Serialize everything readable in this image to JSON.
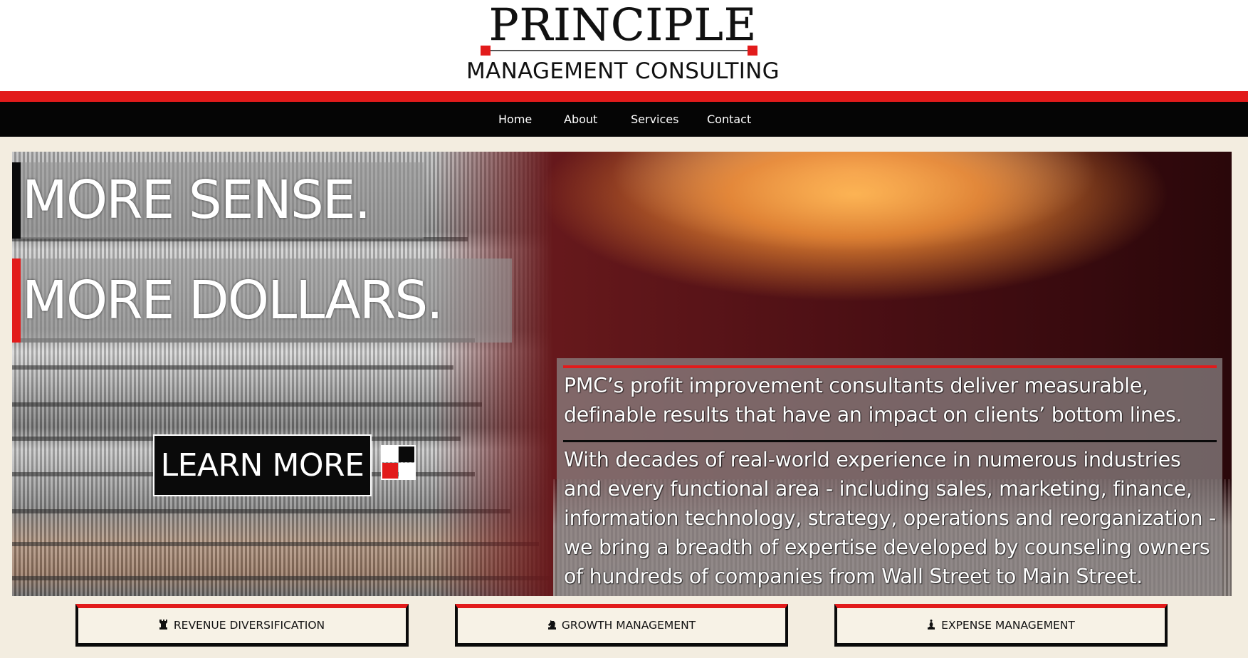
{
  "logo": {
    "name": "PRINCIPLE",
    "subtitle": "MANAGEMENT CONSULTING"
  },
  "nav": {
    "items": [
      {
        "label": "Home"
      },
      {
        "label": "About"
      },
      {
        "label": "Services"
      },
      {
        "label": "Contact"
      }
    ]
  },
  "hero": {
    "headline_1": "MORE SENSE.",
    "headline_2": "MORE DOLLARS.",
    "cta_label": "LEARN MORE",
    "paragraph_1": "PMC’s profit improvement consultants deliver measurable, definable results that have an impact on clients’ bottom lines.",
    "paragraph_2": "With decades of real-world experience in numerous industries and every functional area - including sales, marketing, finance, information technology, strategy, operations and reorganization - we bring a breadth of expertise developed by counseling owners of hundreds of companies from Wall Street to Main Street."
  },
  "services": [
    {
      "label": "REVENUE DIVERSIFICATION",
      "icon": "chess-rook-icon"
    },
    {
      "label": "GROWTH MANAGEMENT",
      "icon": "chess-knight-icon"
    },
    {
      "label": "EXPENSE MANAGEMENT",
      "icon": "chess-bishop-icon"
    }
  ],
  "colors": {
    "accent_red": "#e21b1b",
    "nav_black": "#050505",
    "page_bg": "#f3ede0"
  }
}
